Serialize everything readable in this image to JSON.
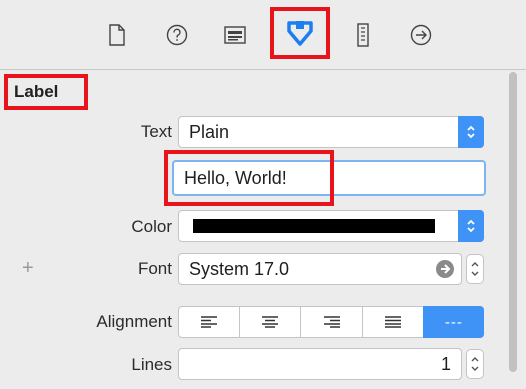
{
  "toolbar": {
    "tools": [
      {
        "name": "file-inspector",
        "icon": "document-icon"
      },
      {
        "name": "quick-help",
        "icon": "question-icon"
      },
      {
        "name": "identity-inspector",
        "icon": "identity-card-icon"
      },
      {
        "name": "attributes-inspector",
        "icon": "attributes-shield-icon",
        "selected": true
      },
      {
        "name": "size-inspector",
        "icon": "ruler-icon"
      },
      {
        "name": "connections-inspector",
        "icon": "arrow-circle-icon"
      }
    ]
  },
  "section": {
    "title": "Label"
  },
  "fields": {
    "text": {
      "label": "Text",
      "value": "Plain"
    },
    "content": {
      "value": "Hello, World!"
    },
    "color": {
      "label": "Color",
      "swatch": "#000000"
    },
    "font": {
      "label": "Font",
      "value": "System 17.0"
    },
    "alignment": {
      "label": "Alignment",
      "options": [
        "left",
        "center",
        "right",
        "justified",
        "natural"
      ],
      "natural_glyph": "---"
    },
    "lines": {
      "label": "Lines",
      "value": "1"
    }
  },
  "colors": {
    "accent": "#3f93f6",
    "highlight": "#e8141c"
  }
}
